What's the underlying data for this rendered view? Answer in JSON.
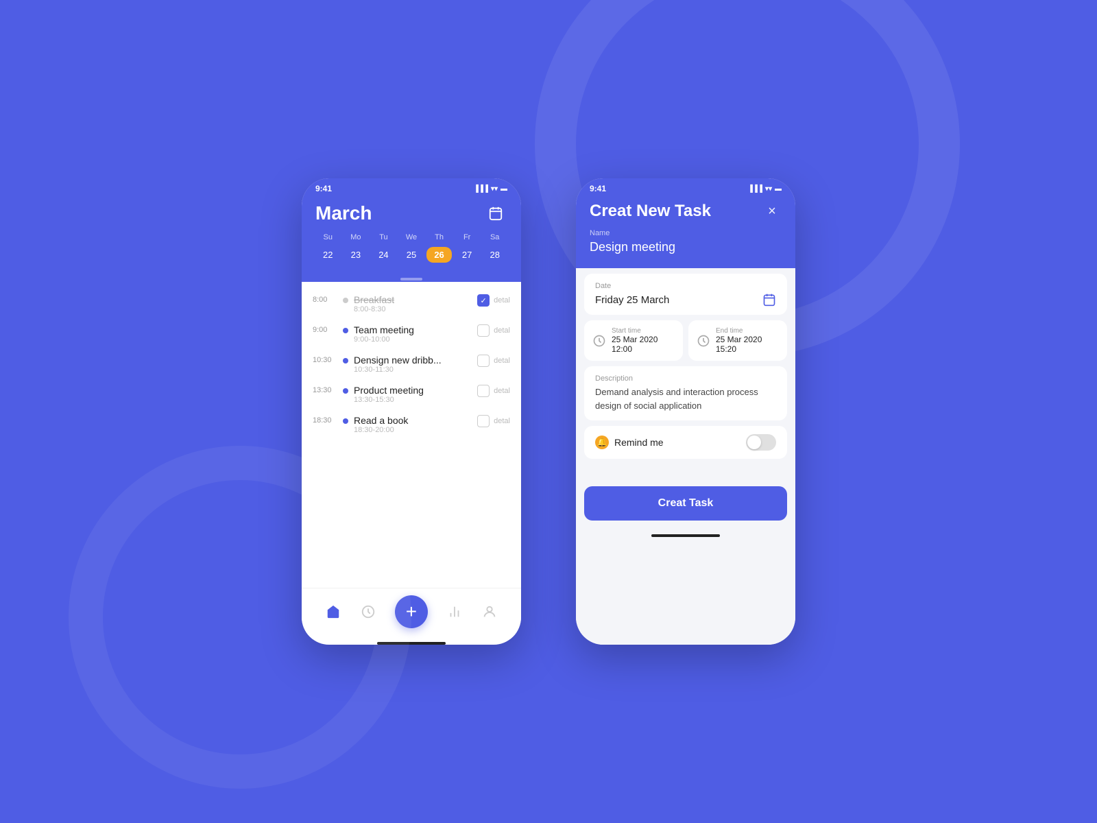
{
  "background": "#4f5de4",
  "phone1": {
    "status_time": "9:41",
    "header": {
      "month": "March",
      "days_labels": [
        "Su",
        "Mo",
        "Tu",
        "We",
        "Th",
        "Fr",
        "Sa"
      ],
      "days_numbers": [
        "22",
        "23",
        "24",
        "25",
        "26",
        "27",
        "28"
      ],
      "active_day": "26"
    },
    "tasks": [
      {
        "time": "8:00",
        "name": "Breakfast",
        "duration": "8:00-8:30",
        "done": true,
        "dot": "gray"
      },
      {
        "time": "9:00",
        "name": "Team meeting",
        "duration": "9:00-10:00",
        "done": false,
        "dot": "blue"
      },
      {
        "time": "10:30",
        "name": "Densign new dribb...",
        "duration": "10:30-11:30",
        "done": false,
        "dot": "blue"
      },
      {
        "time": "13:30",
        "name": "Product meeting",
        "duration": "13:30-15:30",
        "done": false,
        "dot": "blue"
      },
      {
        "time": "18:30",
        "name": "Read a book",
        "duration": "18:30-20:00",
        "done": false,
        "dot": "blue"
      }
    ],
    "nav": {
      "items": [
        "home",
        "clock",
        "plus",
        "chart",
        "person"
      ],
      "detail_label": "detal"
    }
  },
  "phone2": {
    "status_time": "9:41",
    "header": {
      "title": "Creat New Task",
      "close": "×",
      "name_label": "Name",
      "name_value": "Design meeting"
    },
    "form": {
      "date_label": "Date",
      "date_value": "Friday 25 March",
      "start_label": "Start time",
      "start_value": "25 Mar 2020  12:00",
      "end_label": "End time",
      "end_value": "25 Mar 2020  15:20",
      "description_label": "Description",
      "description_value": "Demand analysis and interaction process design of social application",
      "remind_label": "Remind me",
      "create_button": "Creat Task"
    }
  }
}
